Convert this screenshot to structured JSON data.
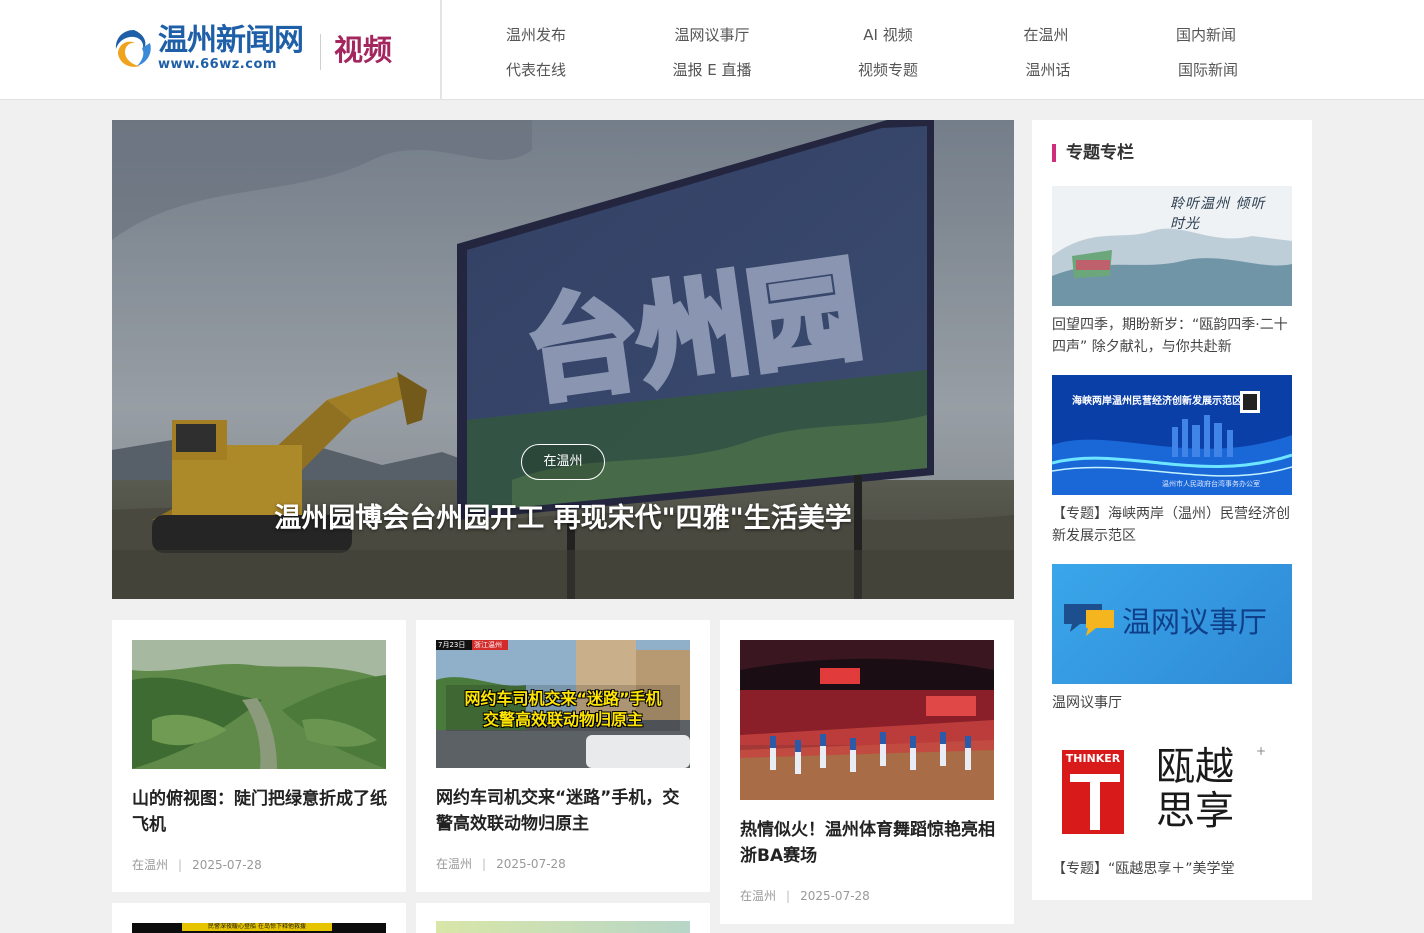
{
  "header": {
    "logo_cn": "温州新闻网",
    "logo_url": "www.66wz.com",
    "channel": "视频",
    "nav_row1": [
      "温州发布",
      "温网议事厅",
      "AI 视频",
      "在温州",
      "国内新闻"
    ],
    "nav_row2": [
      "代表在线",
      "温报 E 直播",
      "视频专题",
      "温州话",
      "国际新闻"
    ]
  },
  "hero": {
    "sign_text": "台州园",
    "title": "温州园博会台州园开工 再现宋代\"四雅\"生活美学",
    "tag": "在温州"
  },
  "cards": [
    {
      "title": "山的俯视图：陡门把绿意折成了纸飞机",
      "source": "在温州",
      "separator": "|",
      "date": "2025-07-28"
    },
    {
      "title": "网约车司机交来“迷路”手机，交警高效联动物归原主",
      "thumb_caption": "网约车司机交来“迷路”手机\n交警高效联动物归原主",
      "thumb_date": "7月23日",
      "thumb_tag": "浙江温州",
      "source": "在温州",
      "separator": "|",
      "date": "2025-07-28"
    },
    {
      "title": "热情似火！温州体育舞蹈惊艳亮相浙BA赛场",
      "source": "在温州",
      "separator": "|",
      "date": "2025-07-28"
    }
  ],
  "bottom_cards": [
    {
      "thumb_caption": "民警深夜暖心登船 在岛惊下释他救援"
    }
  ],
  "sidebar": {
    "title": "专题专栏",
    "items": [
      {
        "img_text": "聆听温州 倾听时光",
        "caption": "回望四季，期盼新岁：“瓯韵四季·二十四声” 除夕献礼，与你共赴新"
      },
      {
        "img_text": "海峡两岸温州民营经济创新发展示范区",
        "img_sub": "温州市人民政府台湾事务办公室",
        "caption": "【专题】海峡两岸（温州）民营经济创新发展示范区"
      },
      {
        "img_text": "温网议事厅",
        "caption": "温网议事厅"
      },
      {
        "img_text_en": "THINKER",
        "img_text_cn": "瓯越思享",
        "caption": "【专题】“瓯越思享＋”美学堂"
      }
    ]
  },
  "colors": {
    "brand_blue": "#1f5fa8",
    "channel_magenta": "#a3265e",
    "accent_pink": "#d02d7a",
    "page_bg": "#f0f0f0"
  }
}
